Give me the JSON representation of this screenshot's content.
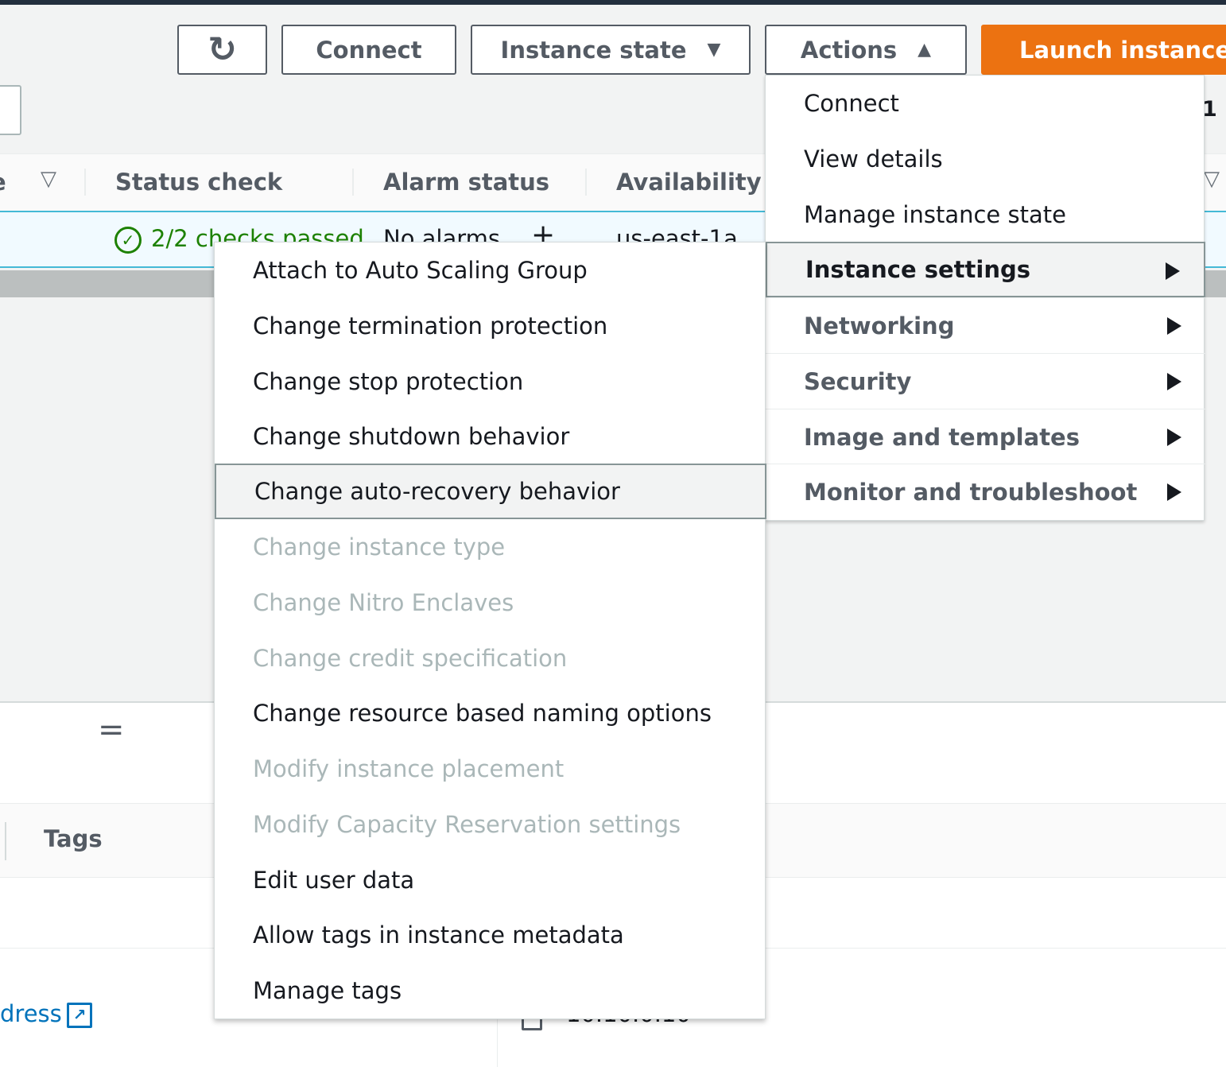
{
  "toolbar": {
    "connect_label": "Connect",
    "instance_state_label": "Instance state",
    "actions_label": "Actions",
    "launch_label": "Launch instances",
    "refresh_icon": "↻"
  },
  "pagination": {
    "current": "1"
  },
  "table": {
    "headers": [
      "Status check",
      "Alarm status",
      "Availability Z"
    ],
    "row": {
      "status_check": "2/2 checks passed",
      "alarm_status": "No alarms",
      "availability_zone": "us-east-1a"
    }
  },
  "details": {
    "tabs_tags": "Tags",
    "address_link": "dress",
    "private_ip": "10.10.0.10"
  },
  "actions_menu": {
    "items": [
      {
        "label": "Connect"
      },
      {
        "label": "View details"
      },
      {
        "label": "Manage instance state"
      },
      {
        "label": "Instance settings"
      },
      {
        "label": "Networking"
      },
      {
        "label": "Security"
      },
      {
        "label": "Image and templates"
      },
      {
        "label": "Monitor and troubleshoot"
      }
    ]
  },
  "instance_settings_menu": {
    "items": [
      {
        "label": "Attach to Auto Scaling Group",
        "disabled": false
      },
      {
        "label": "Change termination protection",
        "disabled": false
      },
      {
        "label": "Change stop protection",
        "disabled": false
      },
      {
        "label": "Change shutdown behavior",
        "disabled": false
      },
      {
        "label": "Change auto-recovery behavior",
        "disabled": false
      },
      {
        "label": "Change instance type",
        "disabled": true
      },
      {
        "label": "Change Nitro Enclaves",
        "disabled": true
      },
      {
        "label": "Change credit specification",
        "disabled": true
      },
      {
        "label": "Change resource based naming options",
        "disabled": false
      },
      {
        "label": "Modify instance placement",
        "disabled": true
      },
      {
        "label": "Modify Capacity Reservation settings",
        "disabled": true
      },
      {
        "label": "Edit user data",
        "disabled": false
      },
      {
        "label": "Allow tags in instance metadata",
        "disabled": false
      },
      {
        "label": "Manage tags",
        "disabled": false
      }
    ]
  },
  "colors": {
    "launch_button": "#ec7211",
    "status_ok": "#1d8102",
    "selected_row_border": "#44b9d6",
    "link": "#0073bb"
  }
}
